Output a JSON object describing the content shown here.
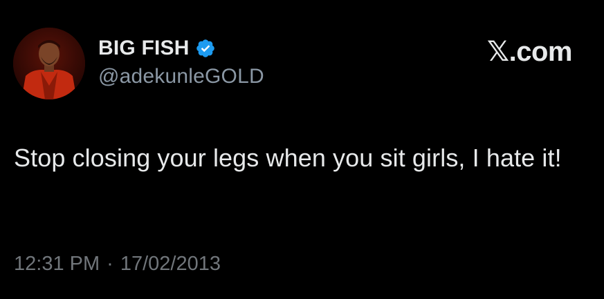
{
  "author": {
    "display_name": "BIG FISH",
    "handle": "@adekunleGOLD",
    "verified": true,
    "verified_badge": "verified-badge-icon"
  },
  "brand": {
    "label": "𝕏.com"
  },
  "tweet": {
    "text": "Stop closing your legs when you sit girls, I hate it!",
    "time": "12:31 PM",
    "separator": "·",
    "date": "17/02/2013"
  },
  "colors": {
    "background": "#000000",
    "primary_text": "#e7e9ea",
    "secondary_text": "#71767b",
    "verified": "#1d9bf0"
  }
}
